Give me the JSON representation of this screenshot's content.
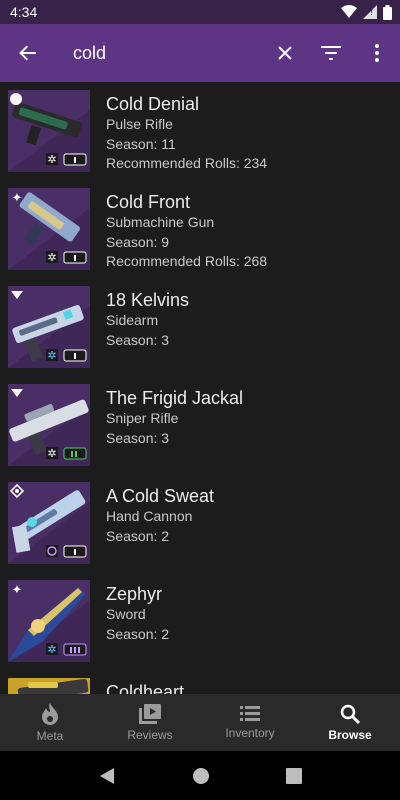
{
  "status": {
    "time": "4:34"
  },
  "search": {
    "value": "cold"
  },
  "results": [
    {
      "name": "Cold Denial",
      "type": "Pulse Rifle",
      "season": "Season: 11",
      "rolls": "Recommended Rolls: 234",
      "bg": "#4a2e66",
      "accent": "#2e6b4e"
    },
    {
      "name": "Cold Front",
      "type": "Submachine Gun",
      "season": "Season: 9",
      "rolls": "Recommended Rolls: 268",
      "bg": "#4a2e66",
      "accent": "#d7c98a"
    },
    {
      "name": "18 Kelvins",
      "type": "Sidearm",
      "season": "Season: 3",
      "rolls": "",
      "bg": "#4a2e66",
      "accent": "#c8d5e6"
    },
    {
      "name": "The Frigid Jackal",
      "type": "Sniper Rifle",
      "season": "Season: 3",
      "rolls": "",
      "bg": "#4a2e66",
      "accent": "#d9dde6"
    },
    {
      "name": "A Cold Sweat",
      "type": "Hand Cannon",
      "season": "Season: 2",
      "rolls": "",
      "bg": "#4a2e66",
      "accent": "#bcd1ea"
    },
    {
      "name": "Zephyr",
      "type": "Sword",
      "season": "Season: 2",
      "rolls": "",
      "bg": "#4a2e66",
      "accent": "#2b4a9a"
    },
    {
      "name": "Coldheart",
      "type": "",
      "season": "",
      "rolls": "",
      "bg": "#c9a227",
      "accent": "#e4c64a"
    }
  ],
  "nav": {
    "meta": "Meta",
    "reviews": "Reviews",
    "inventory": "Inventory",
    "browse": "Browse"
  }
}
